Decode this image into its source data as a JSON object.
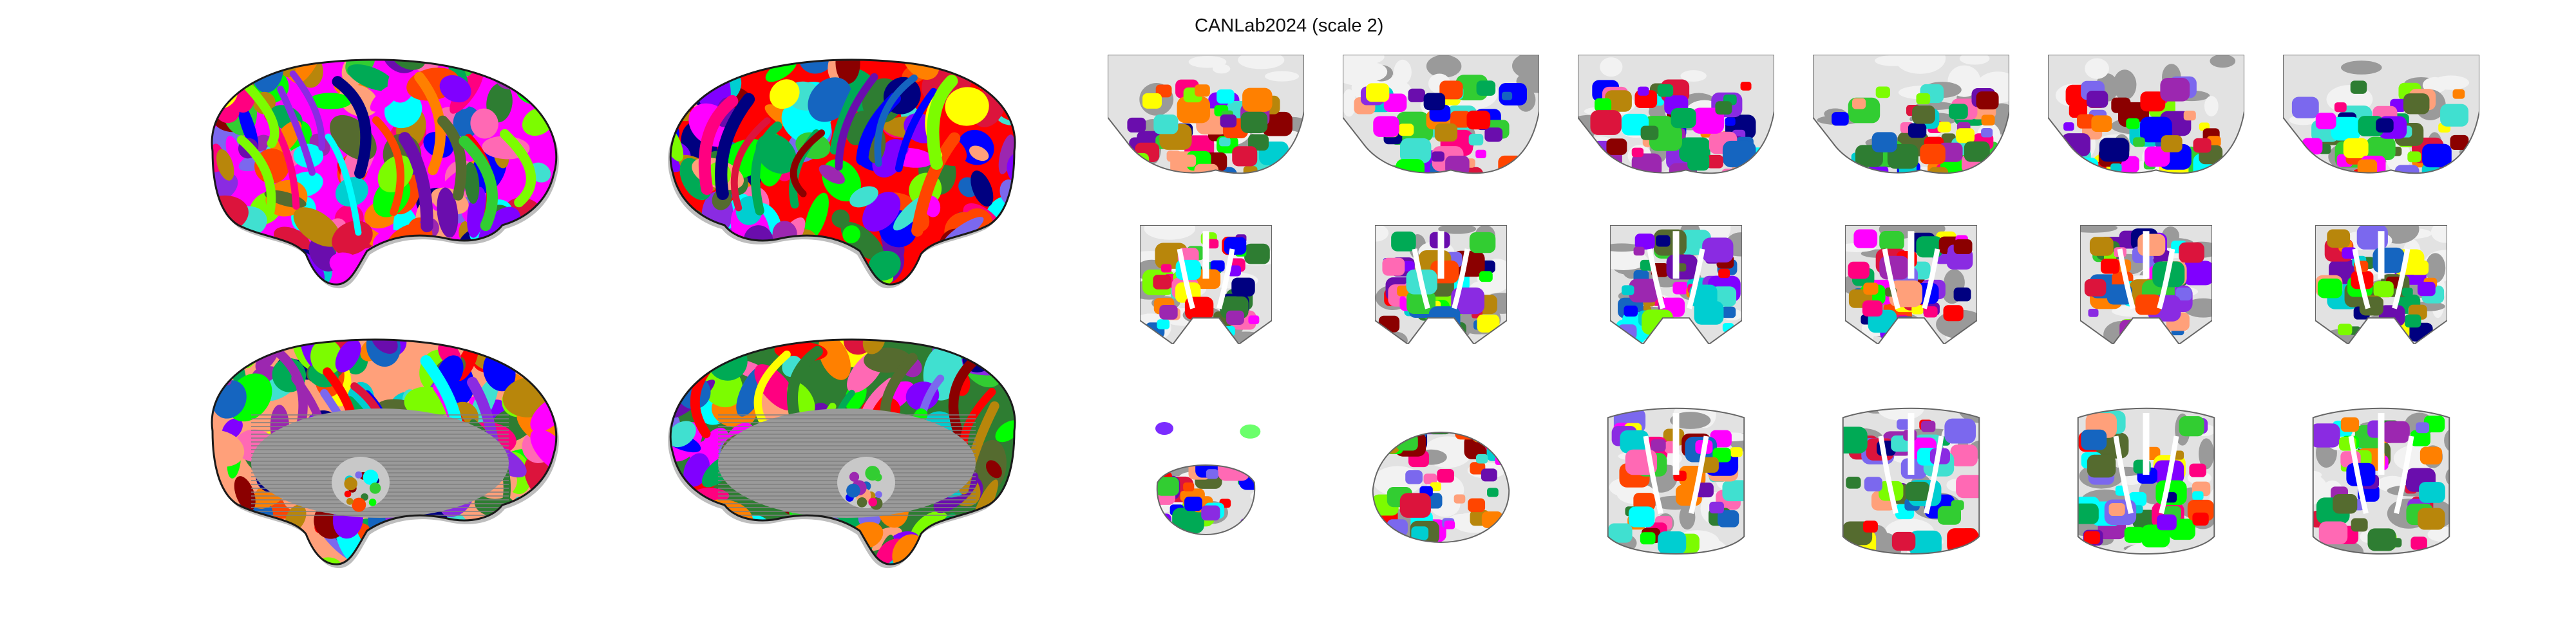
{
  "figure": {
    "title": "CANLab2024 (scale 2)"
  },
  "palette": [
    "#ff00ff",
    "#00ff00",
    "#ff0000",
    "#0000ff",
    "#ffff00",
    "#00ffff",
    "#ff8000",
    "#8000ff",
    "#00aa55",
    "#ff0080",
    "#2e7d32",
    "#9c27b0",
    "#1565c0",
    "#8b0000",
    "#7cfc00",
    "#ff69b4",
    "#40e0d0",
    "#b8860b",
    "#6a0dad",
    "#000080",
    "#ff4500",
    "#32cd32",
    "#dc143c",
    "#8a2be2",
    "#00ced1",
    "#7b68ee",
    "#556b2f",
    "#ffa07a"
  ],
  "surface_views": [
    {
      "name": "lateral-left"
    },
    {
      "name": "lateral-right"
    },
    {
      "name": "medial-left"
    },
    {
      "name": "medial-right"
    }
  ],
  "slice_rows": [
    {
      "orientation": "sagittal",
      "count": 6
    },
    {
      "orientation": "coronal",
      "count": 6
    },
    {
      "orientation": "axial",
      "count": 6
    }
  ]
}
